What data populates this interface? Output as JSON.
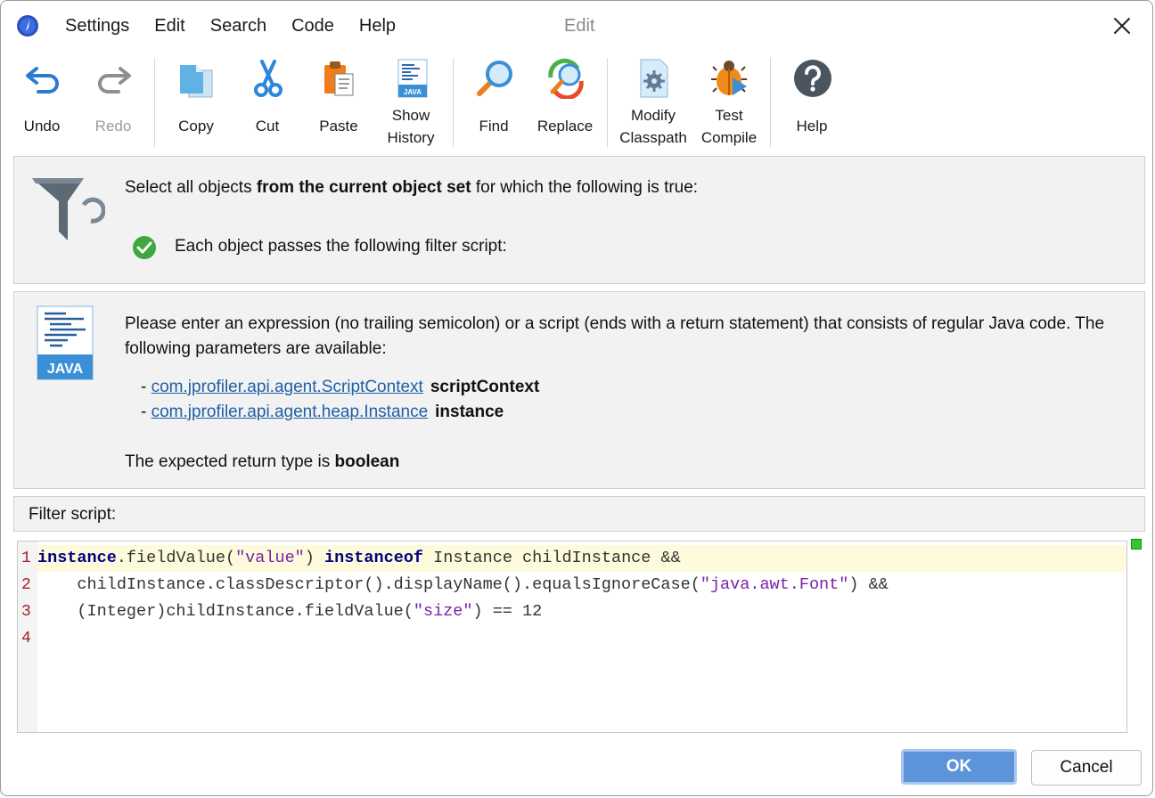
{
  "menu": [
    "Settings",
    "Edit",
    "Search",
    "Code",
    "Help"
  ],
  "window_title": "Edit",
  "toolbar": {
    "undo": "Undo",
    "redo": "Redo",
    "copy": "Copy",
    "cut": "Cut",
    "paste": "Paste",
    "show_history_1": "Show",
    "show_history_2": "History",
    "find": "Find",
    "replace": "Replace",
    "modify_classpath_1": "Modify",
    "modify_classpath_2": "Classpath",
    "test_compile_1": "Test",
    "test_compile_2": "Compile",
    "help": "Help",
    "java_badge": "JAVA"
  },
  "filter": {
    "text_before": "Select all objects ",
    "text_bold": "from the current object set",
    "text_after": " for which the following is true:",
    "condition": "Each object passes the following filter script:"
  },
  "info": {
    "java_label": "JAVA",
    "description": "Please enter an expression (no trailing semicolon) or a script (ends with a return statement) that consists of regular Java code. The following parameters are available:",
    "params": [
      {
        "prefix": "- ",
        "type": "com.jprofiler.api.agent.ScriptContext",
        "name": "scriptContext"
      },
      {
        "prefix": "- ",
        "type": "com.jprofiler.api.agent.heap.Instance",
        "name": "instance"
      }
    ],
    "return_prefix": "The expected return type is ",
    "return_type": "boolean"
  },
  "script_label": "Filter script:",
  "editor": {
    "line_numbers": [
      "1",
      "2",
      "3",
      "4"
    ],
    "line1": {
      "t1": "instance",
      "t2": ".fieldValue(",
      "t3": "\"value\"",
      "t4": ") ",
      "t5": "instanceof",
      "t6": " Instance childInstance &&"
    },
    "line2": {
      "t1": "    childInstance.classDescriptor().displayName().equalsIgnoreCase(",
      "t2": "\"java.awt.Font\"",
      "t3": ") &&"
    },
    "line3": {
      "t1": "    (Integer)childInstance.fieldValue(",
      "t2": "\"size\"",
      "t3": ") == 12"
    }
  },
  "buttons": {
    "ok": "OK",
    "cancel": "Cancel"
  },
  "colors": {
    "ok_button": "#5d93d8",
    "keyword": "#000080",
    "string": "#7a21a8",
    "link": "#1f5fa8",
    "current_line": "#fdfbdc",
    "status_ok": "#2ec92e"
  }
}
